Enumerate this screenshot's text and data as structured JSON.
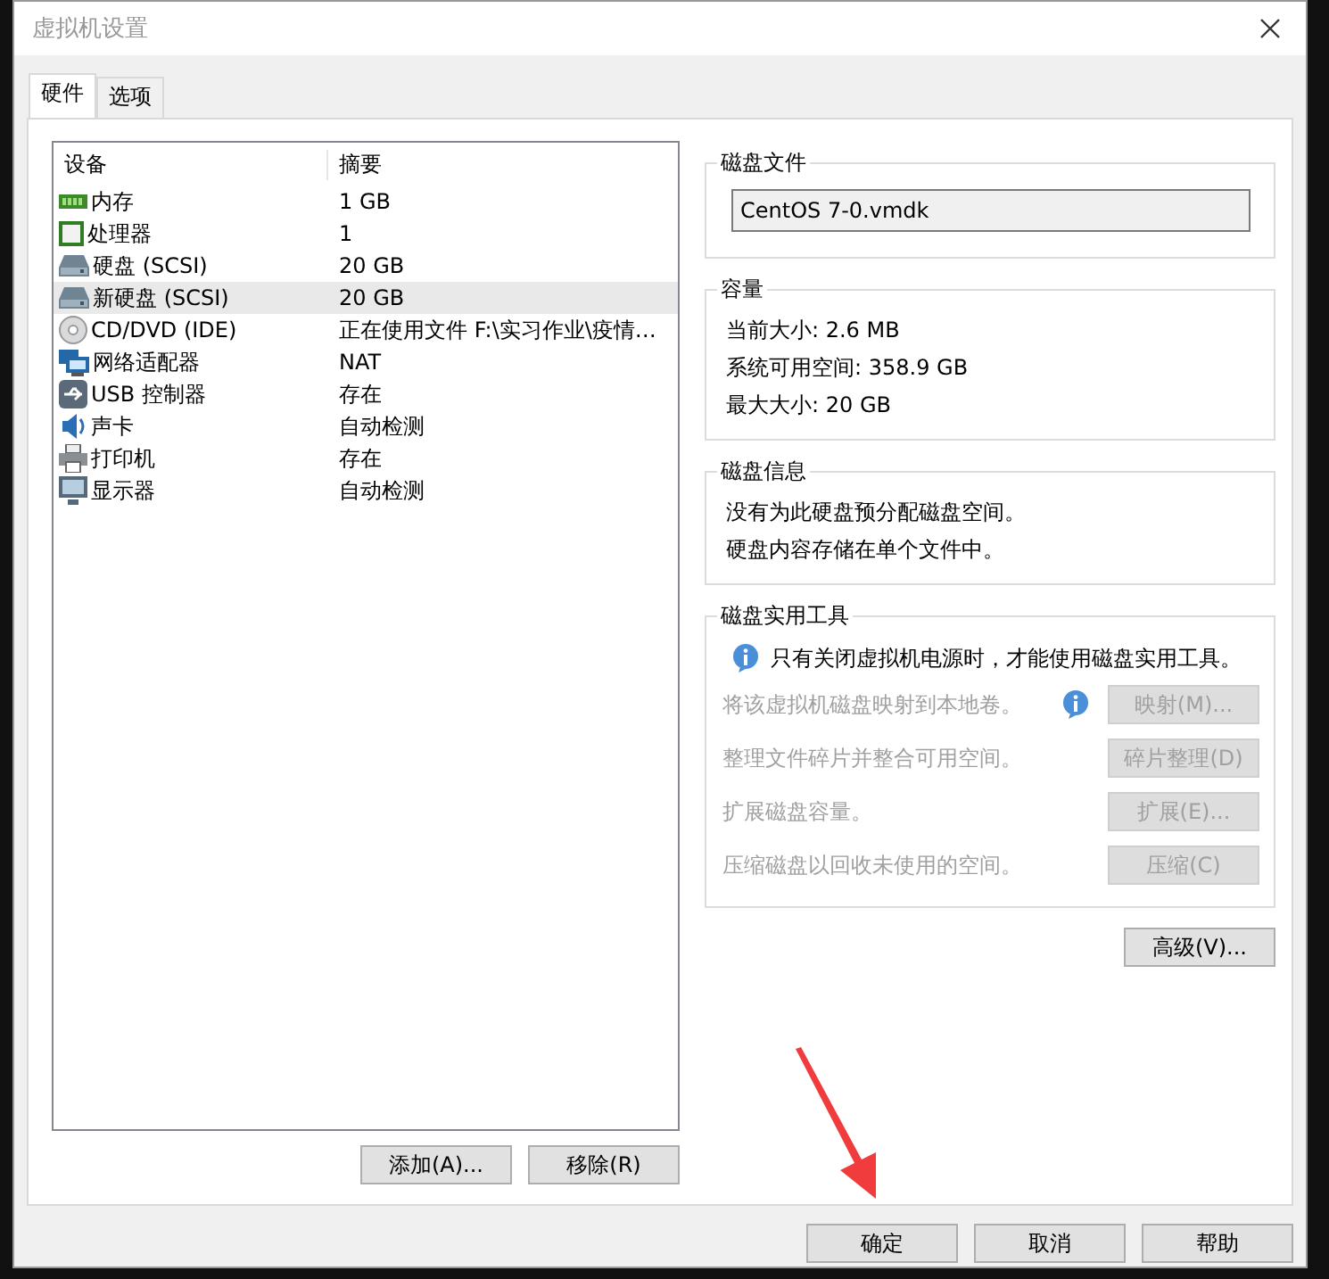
{
  "window": {
    "title": "虚拟机设置"
  },
  "tabs": [
    {
      "label": "硬件",
      "selected": true
    },
    {
      "label": "选项",
      "selected": false
    }
  ],
  "devices": {
    "columns": [
      "设备",
      "摘要"
    ],
    "rows": [
      {
        "kind": "memory",
        "name": "内存",
        "summary": "1 GB",
        "selected": false
      },
      {
        "kind": "cpu",
        "name": "处理器",
        "summary": "1",
        "selected": false
      },
      {
        "kind": "disk",
        "name": "硬盘 (SCSI)",
        "summary": "20 GB",
        "selected": false
      },
      {
        "kind": "disk",
        "name": "新硬盘 (SCSI)",
        "summary": "20 GB",
        "selected": true
      },
      {
        "kind": "cdrom",
        "name": "CD/DVD (IDE)",
        "summary": "正在使用文件 F:\\实习作业\\疫情…",
        "selected": false
      },
      {
        "kind": "network",
        "name": "网络适配器",
        "summary": "NAT",
        "selected": false
      },
      {
        "kind": "usb",
        "name": "USB 控制器",
        "summary": "存在",
        "selected": false
      },
      {
        "kind": "sound",
        "name": "声卡",
        "summary": "自动检测",
        "selected": false
      },
      {
        "kind": "printer",
        "name": "打印机",
        "summary": "存在",
        "selected": false
      },
      {
        "kind": "display",
        "name": "显示器",
        "summary": "自动检测",
        "selected": false
      }
    ]
  },
  "list_buttons": [
    "添加(A)...",
    "移除(R)"
  ],
  "disk_file": {
    "title": "磁盘文件",
    "value": "CentOS 7-0.vmdk"
  },
  "capacity": {
    "title": "容量",
    "lines": [
      "当前大小: 2.6 MB",
      "系统可用空间: 358.9 GB",
      "最大大小: 20 GB"
    ]
  },
  "disk_info": {
    "title": "磁盘信息",
    "lines": [
      "没有为此硬盘预分配磁盘空间。",
      "硬盘内容存储在单个文件中。"
    ]
  },
  "utilities": {
    "title": "磁盘实用工具",
    "note": "只有关闭虚拟机电源时，才能使用磁盘实用工具。",
    "rows": [
      {
        "label": "将该虚拟机磁盘映射到本地卷。",
        "button": "映射(M)...",
        "disabled": true,
        "info_icon": true
      },
      {
        "label": "整理文件碎片并整合可用空间。",
        "button": "碎片整理(D)",
        "disabled": true,
        "info_icon": false
      },
      {
        "label": "扩展磁盘容量。",
        "button": "扩展(E)...",
        "disabled": true,
        "info_icon": false
      },
      {
        "label": "压缩磁盘以回收未使用的空间。",
        "button": "压缩(C)",
        "disabled": true,
        "info_icon": false
      }
    ]
  },
  "advanced_button": "高级(V)...",
  "dialog_buttons": [
    "确定",
    "取消",
    "帮助"
  ]
}
